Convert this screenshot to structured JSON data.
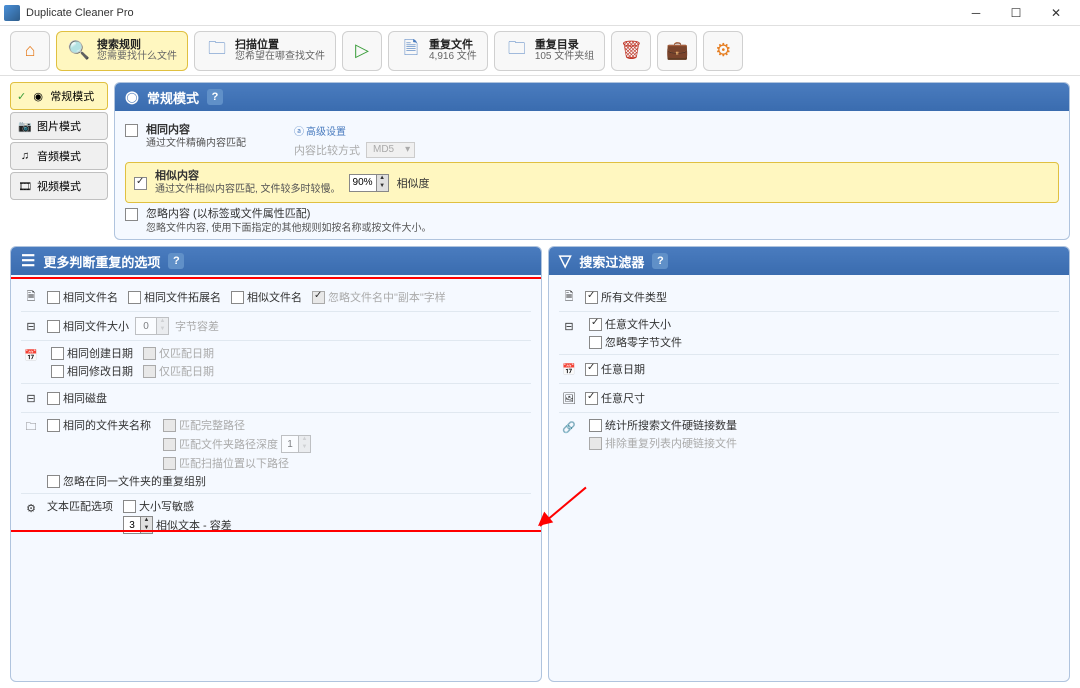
{
  "window": {
    "title": "Duplicate Cleaner Pro"
  },
  "toolbar": {
    "search_rule": {
      "title": "搜索规则",
      "sub": "您需要找什么文件"
    },
    "scan_location": {
      "title": "扫描位置",
      "sub": "您希望在哪查找文件"
    },
    "dup_files": {
      "title": "重复文件",
      "sub": "4,916 文件"
    },
    "dup_dirs": {
      "title": "重复目录",
      "sub": "105 文件夹组"
    }
  },
  "modes": {
    "regular": "常规模式",
    "image": "图片模式",
    "audio": "音频模式",
    "video": "视频模式"
  },
  "regular_panel": {
    "title": "常规模式",
    "same_content": {
      "label": "相同内容",
      "desc": "通过文件精确内容匹配"
    },
    "adv_settings": "高级设置",
    "compare_method_label": "内容比较方式",
    "compare_method_value": "MD5",
    "similar_content": {
      "label": "相似内容",
      "desc": "通过文件相似内容匹配, 文件较多时较慢。",
      "pct": "90%",
      "pct_label": "相似度"
    },
    "ignore_content": {
      "label": "忽略内容  (以标签或文件属性匹配)",
      "desc": "忽略文件内容, 使用下面指定的其他规则如按名称或按文件大小。"
    }
  },
  "options_panel": {
    "title": "更多判断重复的选项",
    "filename": {
      "same_name": "相同文件名",
      "same_ext": "相同文件拓展名",
      "similar_name": "相似文件名",
      "ignore_copy": "忽略文件名中\"副本\"字样"
    },
    "size": {
      "label": "相同文件大小",
      "value": "0",
      "unit": "字节容差"
    },
    "date": {
      "created": "相同创建日期",
      "modified": "相同修改日期",
      "date_only1": "仅匹配日期",
      "date_only2": "仅匹配日期"
    },
    "disk": {
      "label": "相同磁盘"
    },
    "folder": {
      "label": "相同的文件夹名称",
      "full_path": "匹配完整路径",
      "path_depth": "匹配文件夹路径深度",
      "depth_val": "1",
      "below_path": "匹配扫描位置以下路径",
      "ignore_same_group": "忽略在同一文件夹的重复组别"
    },
    "text": {
      "label": "文本匹配选项",
      "case": "大小写敏感",
      "tol_val": "3",
      "tol_label": "相似文本 - 容差"
    }
  },
  "filter_panel": {
    "title": "搜索过滤器",
    "all_types": "所有文件类型",
    "any_size": "任意文件大小",
    "ignore_zero": "忽略零字节文件",
    "any_date": "任意日期",
    "any_dim": "任意尺寸",
    "hardlink": "统计所搜索文件硬链接数量",
    "exclude_hardlink": "排除重复列表内硬链接文件"
  }
}
